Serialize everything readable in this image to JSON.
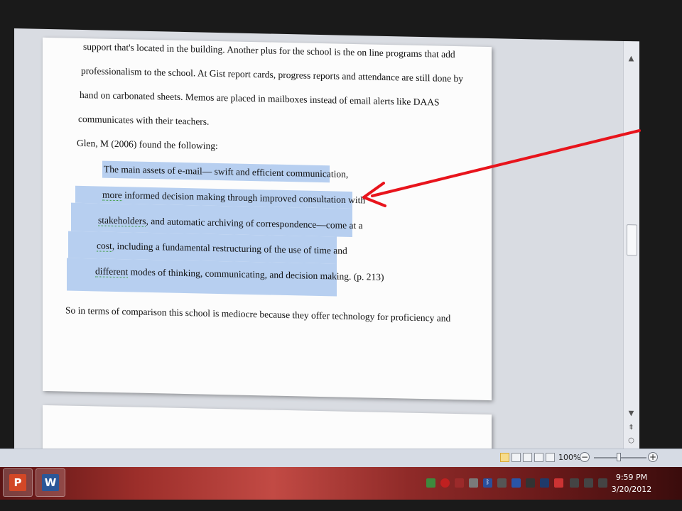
{
  "document": {
    "paragraph1": [
      "support that's located in the building.  Another plus for the school is the on line programs  that add",
      "professionalism  to the school.  At Gist report cards, progress reports and attendance are still done by",
      "hand on carbonated sheets.  Memos are placed in mailboxes instead of email alerts like DAAS",
      "communicates with their teachers."
    ],
    "citation_intro": "Glen, M (2006) found the following:",
    "quote_lines": [
      {
        "pre": "The main assets of e-mail— swift and efficient communication,",
        "spell": "",
        "post": ""
      },
      {
        "pre": "",
        "spell": "more",
        "post": " informed decision making through improved consultation with"
      },
      {
        "pre": "",
        "spell": "stakeholders",
        "post": ", and automatic archiving  of correspondence—come at a"
      },
      {
        "pre": "",
        "spell": "cost",
        "post": ", including a fundamental restructuring of the use of time and"
      },
      {
        "pre": "",
        "spell": "different",
        "post": " modes of thinking,  communicating, and decision making."
      }
    ],
    "quote_page_ref": "(p. 213)",
    "paragraph2": "So in terms of comparison  this school is mediocre because they offer technology  for proficiency and"
  },
  "statusbar": {
    "zoom_level": "100%",
    "zoom_minus": "−",
    "zoom_plus": "+",
    "zoom_fraction": 0.5
  },
  "taskbar": {
    "apps": [
      {
        "name": "PowerPoint",
        "letter": "P",
        "color": "#d24726"
      },
      {
        "name": "Word",
        "letter": "W",
        "color": "#2b5797"
      }
    ],
    "clock_time": "9:59 PM",
    "clock_date": "3/20/2012"
  },
  "annotation": {
    "arrow_color": "#e8141c"
  }
}
